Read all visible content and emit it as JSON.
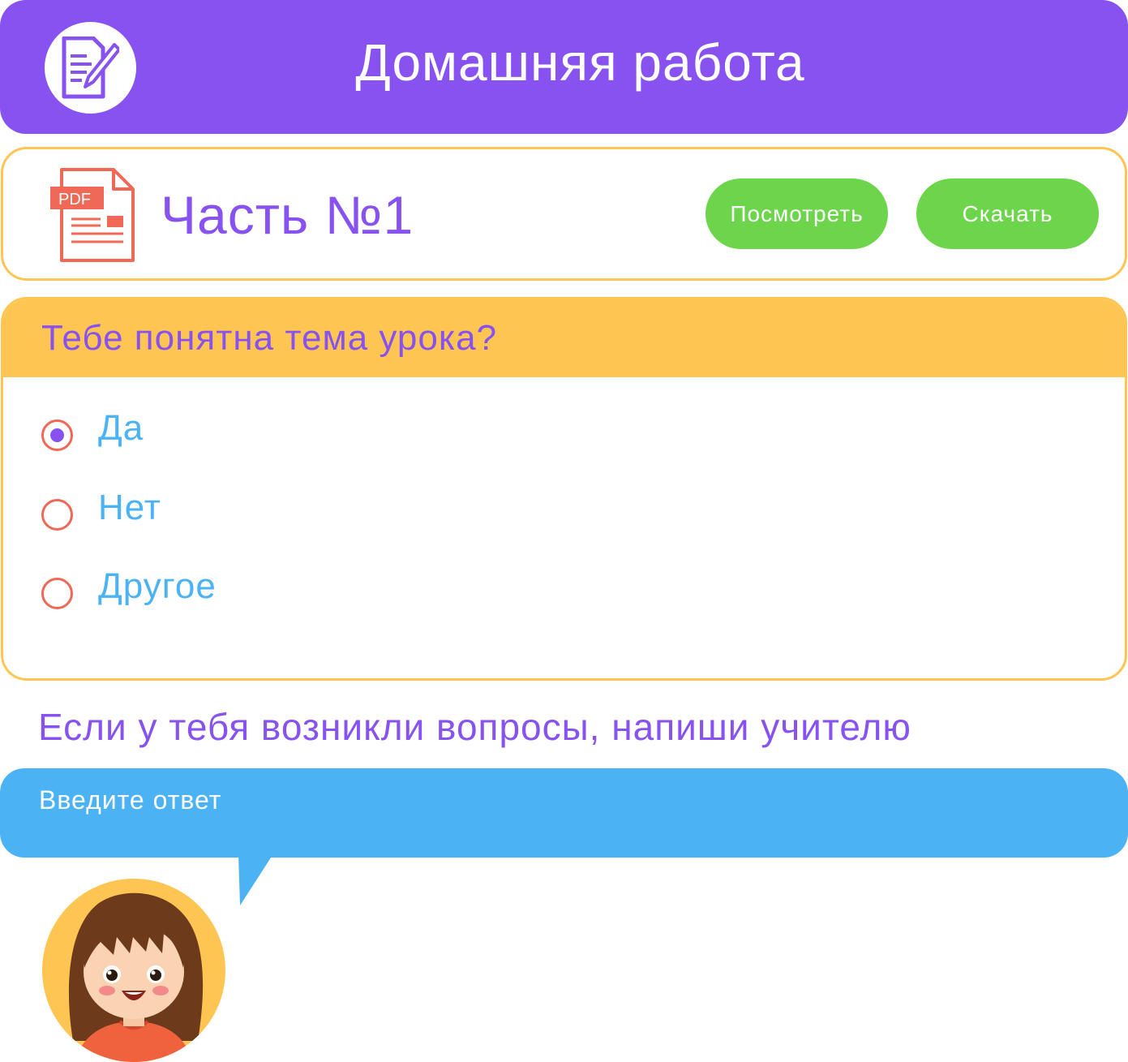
{
  "header": {
    "title": "Домашняя работа",
    "logo_icon": "document-pencil-icon"
  },
  "part": {
    "file_icon": "pdf-file-icon",
    "file_badge": "PDF",
    "title": "Часть №1",
    "view_label": "Посмотреть",
    "download_label": "Скачать"
  },
  "question": {
    "title": "Тебе понятна тема урока?",
    "options": [
      {
        "label": "Да",
        "selected": true
      },
      {
        "label": "Нет",
        "selected": false
      },
      {
        "label": "Другое",
        "selected": false
      }
    ]
  },
  "hint": "Если у тебя возникли вопросы, напиши учителю",
  "answer": {
    "placeholder": "Введите ответ",
    "value": ""
  },
  "avatar": {
    "icon": "girl-avatar"
  },
  "colors": {
    "purple": "#8752F0",
    "yellow": "#FFC552",
    "green": "#6CD54C",
    "blue": "#4BB3F4",
    "red": "#F06856"
  }
}
